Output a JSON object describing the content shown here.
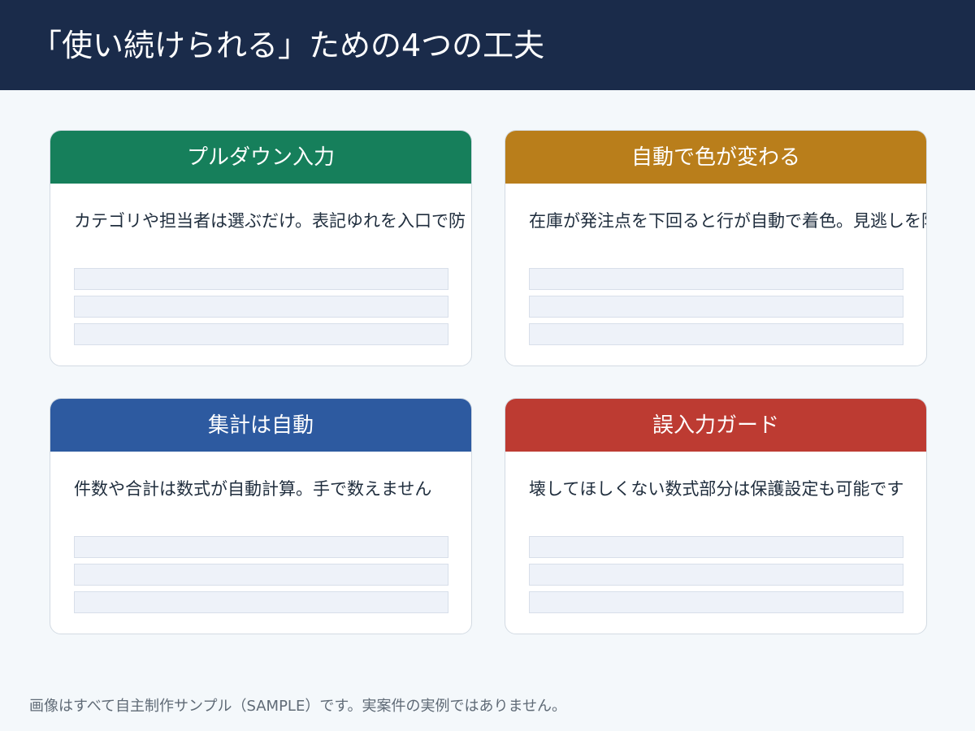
{
  "header": {
    "title": "「使い続けられる」ための4つの工夫",
    "background_color": "#1a2b4a"
  },
  "cards": [
    {
      "title": "プルダウン入力",
      "description": "カテゴリや担当者は選ぶだけ。表記ゆれを入口で防",
      "header_color": "#167f5b"
    },
    {
      "title": "自動で色が変わる",
      "description": "在庫が発注点を下回ると行が自動で着色。見逃しを防",
      "header_color": "#b97e1b"
    },
    {
      "title": "集計は自動",
      "description": "件数や合計は数式が自動計算。手で数えません",
      "header_color": "#2d5aa0"
    },
    {
      "title": "誤入力ガード",
      "description": "壊してほしくない数式部分は保護設定も可能です",
      "header_color": "#bd3b32"
    }
  ],
  "footer": {
    "note": "画像はすべて自主制作サンプル（SAMPLE）です。実案件の実例ではありません。"
  }
}
